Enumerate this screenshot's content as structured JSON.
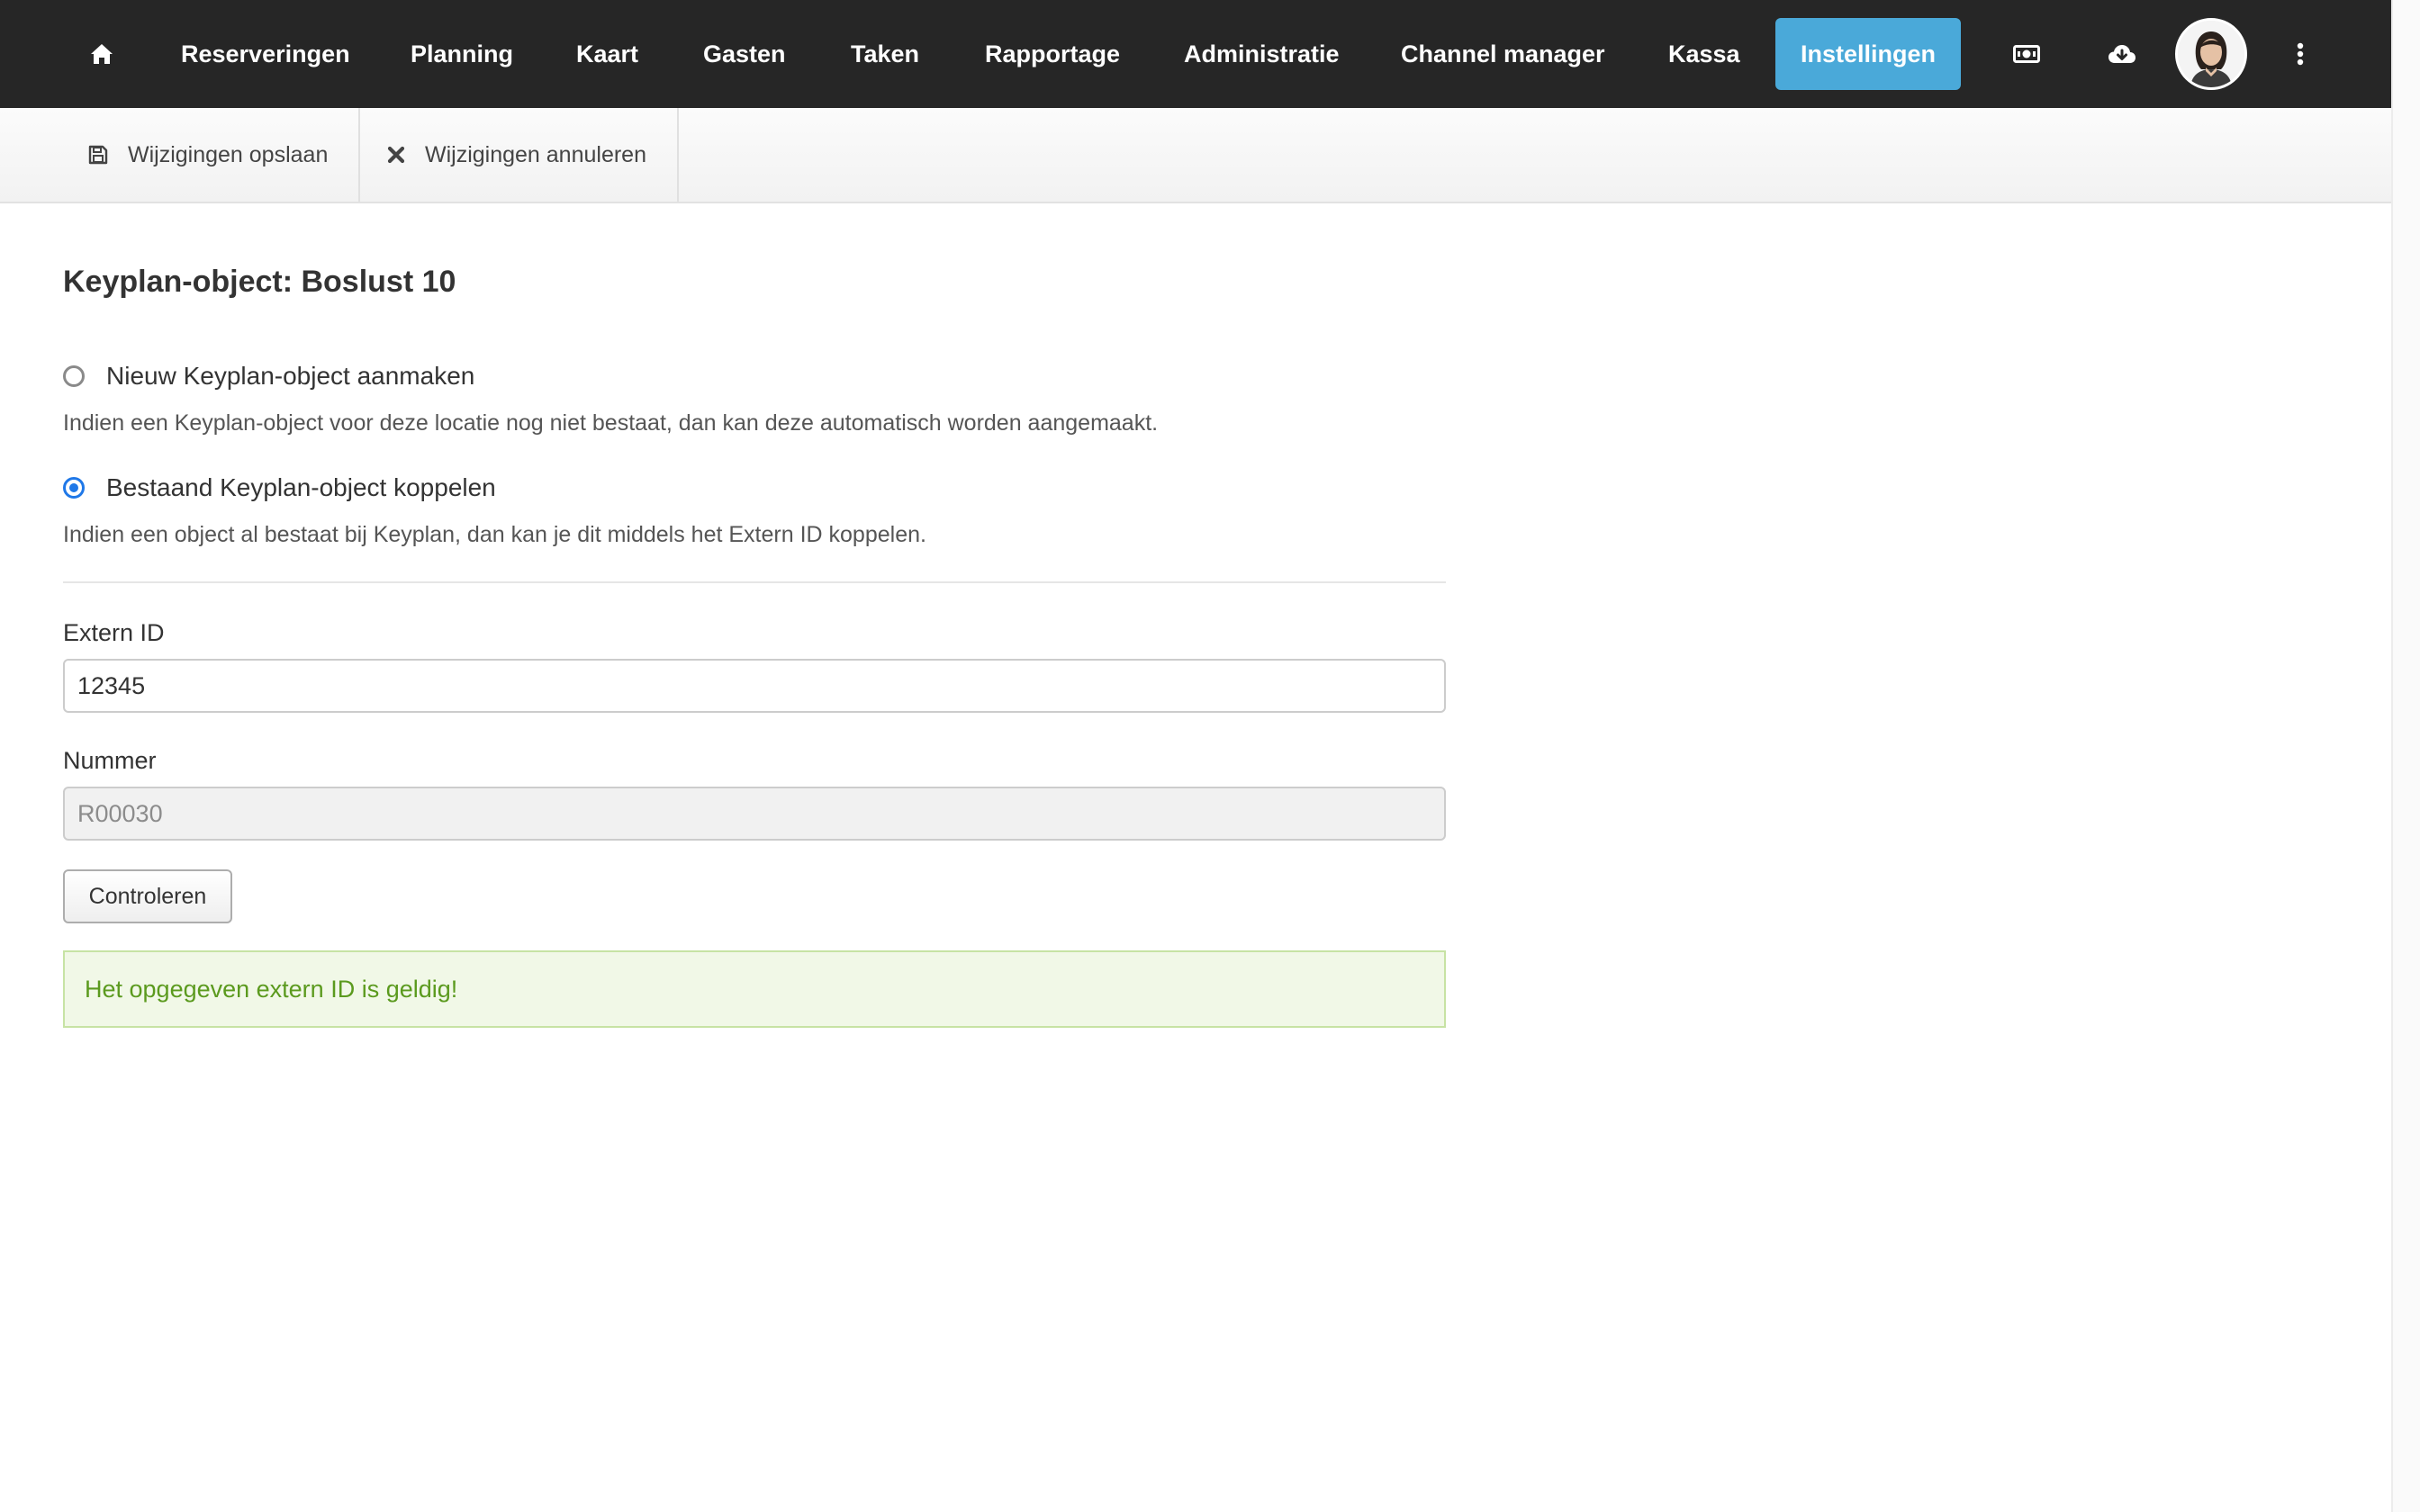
{
  "nav": {
    "home_icon": "home-icon",
    "items": [
      {
        "label": "Reserveringen"
      },
      {
        "label": "Planning"
      },
      {
        "label": "Kaart"
      },
      {
        "label": "Gasten"
      },
      {
        "label": "Taken"
      },
      {
        "label": "Rapportage"
      },
      {
        "label": "Administratie"
      },
      {
        "label": "Channel manager"
      },
      {
        "label": "Kassa"
      },
      {
        "label": "Instellingen",
        "active": true
      }
    ],
    "icons": [
      "cash-register-icon",
      "cloud-download-icon",
      "avatar",
      "more-vertical-icon"
    ],
    "active_color": "#4aa9d9",
    "background_color": "#262626"
  },
  "toolbar": {
    "save_label": "Wijzigingen opslaan",
    "save_icon": "floppy-disk-icon",
    "cancel_label": "Wijzigingen annuleren",
    "cancel_icon": "close-icon"
  },
  "main": {
    "title": "Keyplan-object: Boslust 10",
    "options": [
      {
        "label": "Nieuw Keyplan-object aanmaken",
        "help": "Indien een Keyplan-object voor deze locatie nog niet bestaat, dan kan deze automatisch worden aangemaakt.",
        "checked": false
      },
      {
        "label": "Bestaand Keyplan-object koppelen",
        "help": "Indien een object al bestaat bij Keyplan, dan kan je dit middels het Extern ID koppelen.",
        "checked": true
      }
    ],
    "extern_id": {
      "label": "Extern ID",
      "value": "12345"
    },
    "nummer": {
      "label": "Nummer",
      "value": "R00030"
    },
    "check_button_label": "Controleren",
    "success_message": "Het opgegeven extern ID is geldig!",
    "radio_checked_color": "#1f78e8",
    "success_color": "#5b9a1e"
  }
}
